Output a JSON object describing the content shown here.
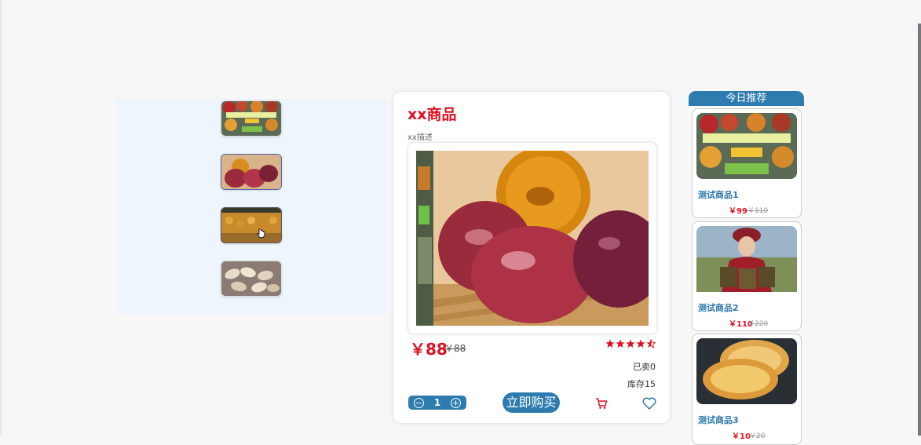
{
  "product": {
    "title": "xx商品",
    "description": "xx描述",
    "price": "￥88",
    "original_price": "￥88",
    "rating_stars": 4.5,
    "sold_label": "已卖0",
    "stock_label": "库存15",
    "quantity": "1",
    "buy_label": "立即购买"
  },
  "thumbnails": [
    {
      "name": "dried-fruits-collage"
    },
    {
      "name": "plums"
    },
    {
      "name": "dried-apricots"
    },
    {
      "name": "seeds"
    }
  ],
  "recommend": {
    "header": "今日推荐",
    "items": [
      {
        "name": "测试商品1",
        "price": "￥99",
        "original_price": "￥110"
      },
      {
        "name": "测试商品2",
        "price": "￥110",
        "original_price": "￥220"
      },
      {
        "name": "测试商品3",
        "price": "￥10",
        "original_price": "￥20"
      }
    ]
  },
  "colors": {
    "accent": "#2e7bb0",
    "price_red": "#e01020"
  }
}
